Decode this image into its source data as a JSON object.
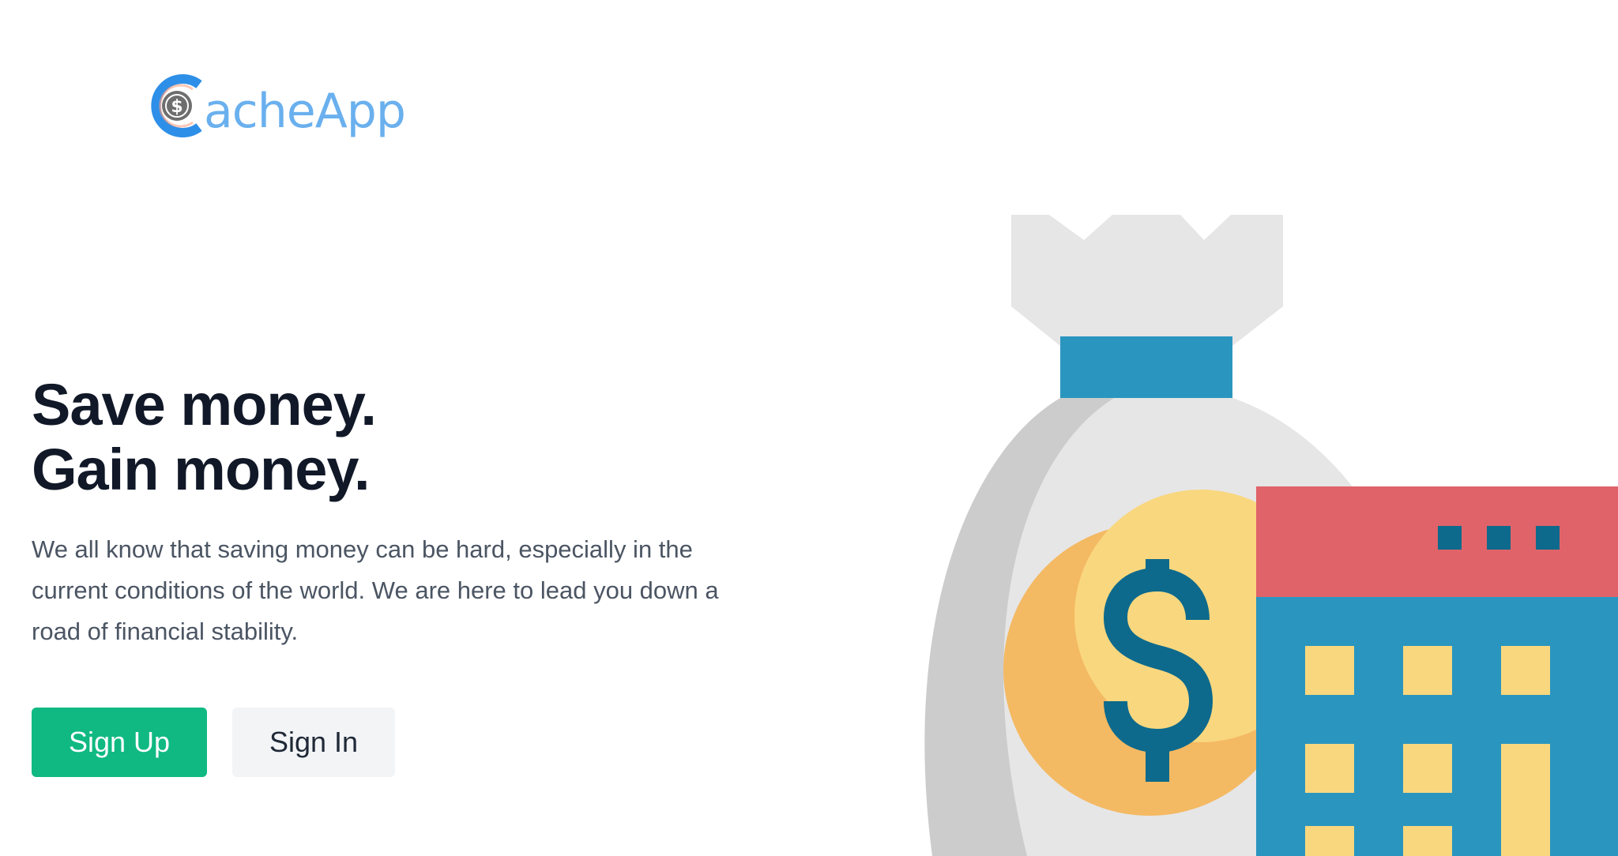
{
  "brand": {
    "logo_icon": "dollar-coin-c-icon",
    "name": "acheApp",
    "color": "#6ab0ee"
  },
  "hero": {
    "headline_line1": "Save money.",
    "headline_line2": "Gain money.",
    "description": "We all know that saving money can be hard, especially in the current conditions of the world. We are here to lead you down a road of financial stability."
  },
  "actions": {
    "sign_up_label": "Sign Up",
    "sign_in_label": "Sign In",
    "primary_color": "#10b981"
  },
  "illustration": {
    "icon": "money-bag-and-bank-building-icon",
    "colors": {
      "bag": "#e6e6e6",
      "bag_shadow": "#cccccc",
      "band": "#2a96c0",
      "coin": "#f9d77e",
      "coin_shadow": "#f4b963",
      "dollar": "#0d6a8c",
      "building": "#2a96c0",
      "roof": "#e0636a",
      "window": "#f9d77e"
    }
  }
}
